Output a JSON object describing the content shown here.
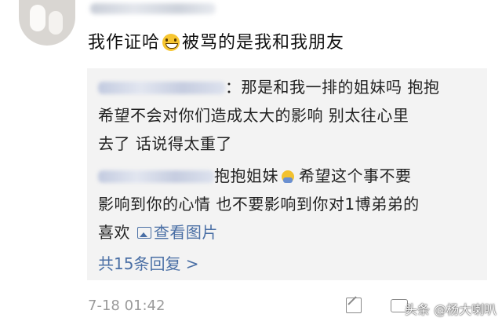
{
  "post": {
    "text_before_emoji": "我作证哈",
    "emoji": "grin-emoji",
    "text_after_emoji": "被骂的是我和我朋友"
  },
  "reply1": {
    "line1": "：那是和我一排的姐妹吗 抱抱",
    "line2": "希望不会对你们造成太大的影响 别太往心里",
    "line3": "去了 话说得太重了"
  },
  "reply2": {
    "line1_a": "抱抱姐妹",
    "emoji": "hug-emoji",
    "line1_b": "希望这个事不要",
    "line2": "影响到你的心情 也不要影响到你对1博弟弟的",
    "line3_text": "喜欢",
    "view_image_label": "查看图片"
  },
  "replies_link": "共15条回复 >",
  "timestamp": "7-18 01:42",
  "watermark": "头条 @杨大喇叭"
}
